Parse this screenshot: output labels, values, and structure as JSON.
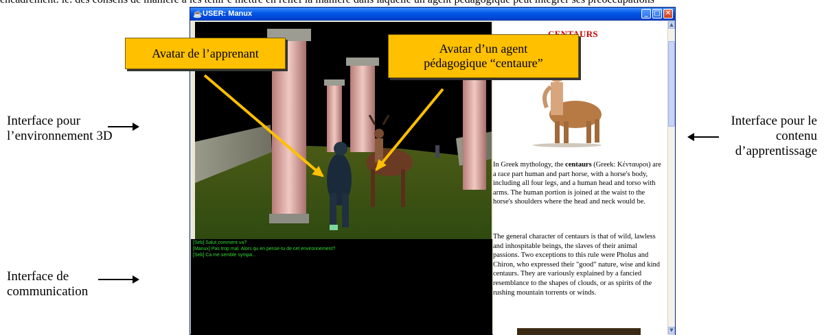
{
  "top_text": "encadrement. ie. des conseils de manière à les tenir                                   e mettre en relief la manière dans laquelle un agent pédagogique peut intégrer ses préoccupations ",
  "annotations": {
    "env_3d": [
      "Interface pour",
      "l’environnement 3D"
    ],
    "communication": [
      "Interface de",
      "communication"
    ],
    "content": [
      "Interface pour le",
      "contenu",
      "d’apprentissage"
    ]
  },
  "callouts": {
    "learner_avatar": "Avatar de l’apprenant",
    "agent_avatar": [
      "Avatar d’un agent",
      "pédagogique “centaure”"
    ]
  },
  "window": {
    "title": "USER: Manux",
    "buttons": {
      "minimize": "_",
      "maximize": "□",
      "close": "✕"
    },
    "icon": "java-cup-icon"
  },
  "chat": {
    "messages": [
      "[Seb] Salut comment va?",
      "[Manux] Pas trop mal. Alors qu en pense-tu de cet environnement?",
      "[Seb] Ca me semble sympa..."
    ]
  },
  "content": {
    "title": "CENTAURS",
    "para1": {
      "before": "In Greek mythology, the ",
      "bold": "centaurs",
      "after": " (Greek: Kένταυροι) are a race part human and part horse, with a horse's body, including all four legs, and a human head and torso with arms. The human portion is joined at the waist to the horse's shoulders where the head and neck would be."
    },
    "para2": "The general character of centaurs is that of wild, lawless and inhospitable beings, the slaves of their animal passions. Two exceptions to this rule were Pholus and Chiron, who expressed their \"good\" nature, wise and kind centaurs. They are variously explained by a fancied resemblance to the shapes of clouds, or as spirits of the rushing mountain torrents or winds."
  },
  "scroll": {
    "up": "▲",
    "down": "▼"
  },
  "colors": {
    "callout": "#ffc000",
    "chat_text": "#33dd33",
    "content_title": "#cc0000",
    "titlebar": "#0055e5"
  }
}
